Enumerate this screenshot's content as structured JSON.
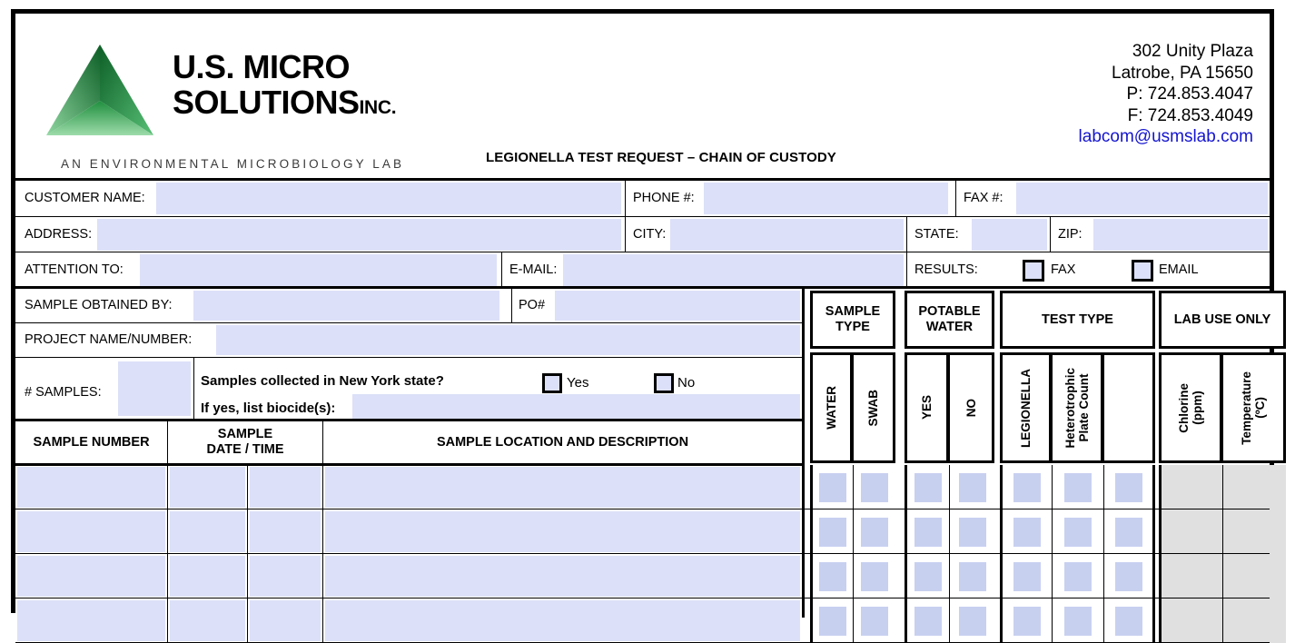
{
  "company": {
    "name_line1": "U.S. MICRO",
    "name_line2": "SOLUTIONS",
    "suffix": "INC.",
    "tagline": "AN ENVIRONMENTAL MICROBIOLOGY LAB"
  },
  "contact": {
    "address": "302 Unity Plaza",
    "city_state_zip": "Latrobe, PA 15650",
    "phone": "P: 724.853.4047",
    "fax": "F: 724.853.4049",
    "email": "labcom@usmslab.com",
    "email_color": "#1414cf"
  },
  "document": {
    "title": "LEGIONELLA TEST REQUEST – CHAIN OF CUSTODY"
  },
  "form": {
    "customer_name_label": "CUSTOMER NAME:",
    "phone_label": "PHONE #:",
    "fax_label": "FAX #:",
    "address_label": "ADDRESS:",
    "city_label": "CITY:",
    "state_label": "STATE:",
    "zip_label": "ZIP:",
    "attention_label": "ATTENTION TO:",
    "email_label": "E-MAIL:",
    "results_label": "RESULTS:",
    "results_fax_option": "FAX",
    "results_email_option": "EMAIL",
    "sample_obtained_label": "SAMPLE OBTAINED BY:",
    "po_label": "PO#",
    "project_label": "PROJECT NAME/NUMBER:",
    "num_samples_label": "# SAMPLES:",
    "ny_question": "Samples collected in New York state?",
    "ny_yes": "Yes",
    "ny_no": "No",
    "biocide_label": "If yes, list biocide(s):",
    "values": {
      "customer_name": "",
      "phone": "",
      "fax": "",
      "address": "",
      "city": "",
      "state": "",
      "zip": "",
      "attention_to": "",
      "email": "",
      "sample_obtained_by": "",
      "po_number": "",
      "project_name_number": "",
      "num_samples": "",
      "biocides": ""
    }
  },
  "table": {
    "group_headers": [
      {
        "label": "SAMPLE\nTYPE"
      },
      {
        "label": "POTABLE\nWATER"
      },
      {
        "label": "TEST TYPE"
      },
      {
        "label": "LAB USE ONLY"
      }
    ],
    "left_headers": [
      {
        "label": "SAMPLE NUMBER"
      },
      {
        "label": "SAMPLE\nDATE / TIME"
      },
      {
        "label": "SAMPLE LOCATION AND DESCRIPTION"
      }
    ],
    "vertical_headers": [
      {
        "label": "WATER"
      },
      {
        "label": "SWAB"
      },
      {
        "label": "YES"
      },
      {
        "label": "NO"
      },
      {
        "label": "LEGIONELLA"
      },
      {
        "label": "Heterotrophic\nPlate Count"
      },
      {
        "label": ""
      },
      {
        "label": "Chlorine\n(ppm)"
      },
      {
        "label": "Temperature\n(ºC)"
      }
    ],
    "rows": [
      {
        "sample_number": "",
        "date": "",
        "time": "",
        "location": ""
      },
      {
        "sample_number": "",
        "date": "",
        "time": "",
        "location": ""
      },
      {
        "sample_number": "",
        "date": "",
        "time": "",
        "location": ""
      },
      {
        "sample_number": "",
        "date": "",
        "time": "",
        "location": ""
      }
    ]
  },
  "colors": {
    "field_fill": "#dce0f8",
    "lab_fill": "#e0e0e0",
    "checkbox_fill": "#c8d0f0",
    "border": "#000000",
    "logo_green": "#1f8f3e"
  }
}
